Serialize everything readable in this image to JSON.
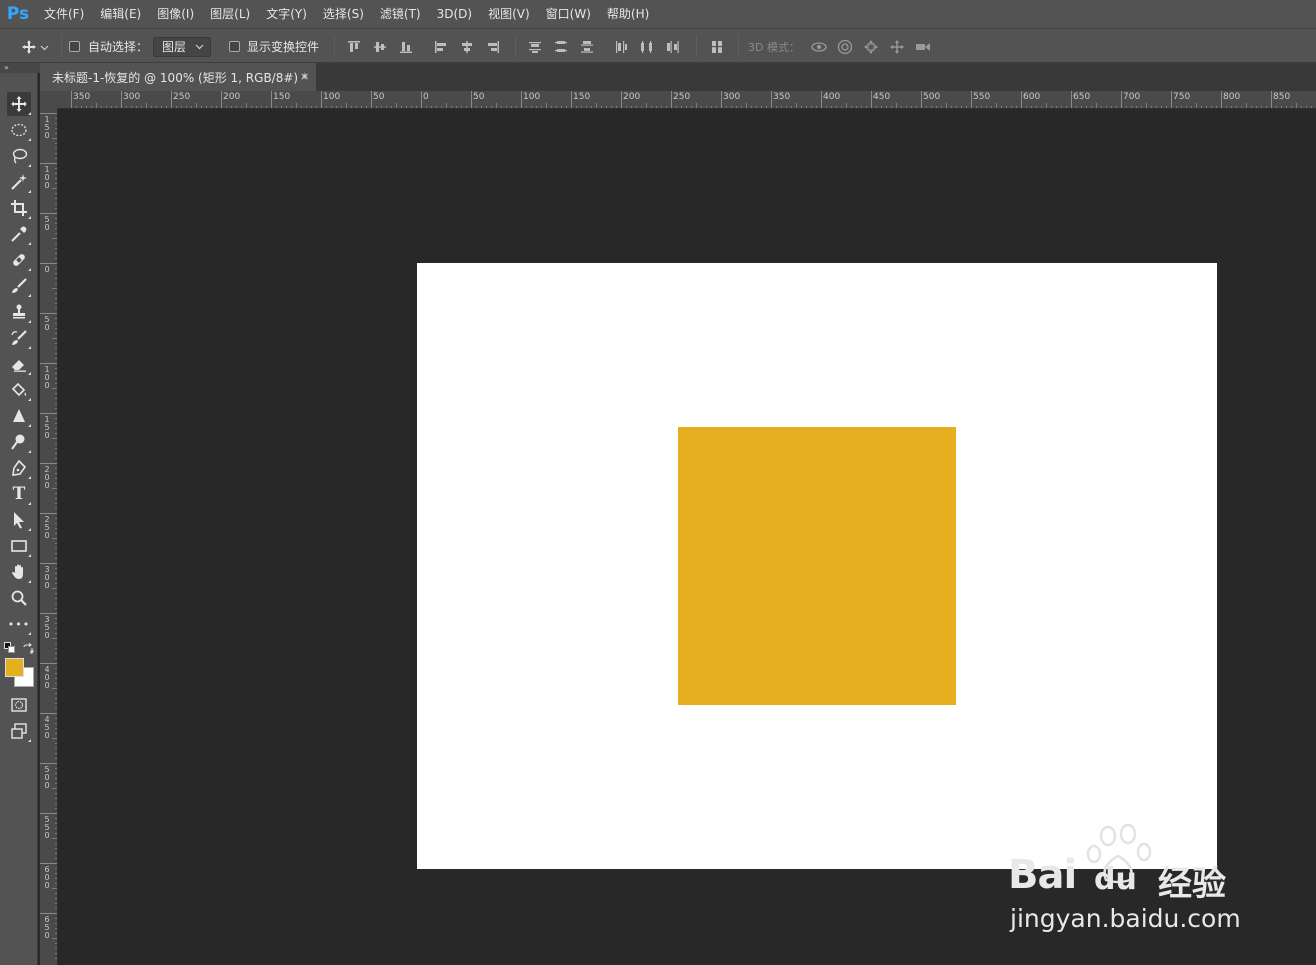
{
  "app": {
    "logo": "Ps"
  },
  "menu": [
    "文件(F)",
    "编辑(E)",
    "图像(I)",
    "图层(L)",
    "文字(Y)",
    "选择(S)",
    "滤镜(T)",
    "3D(D)",
    "视图(V)",
    "窗口(W)",
    "帮助(H)"
  ],
  "options": {
    "auto_select_label": "自动选择：",
    "auto_select_checked": false,
    "layer_select_value": "图层",
    "show_transform_label": "显示变换控件",
    "show_transform_checked": false,
    "mode_3d_label": "3D 模式："
  },
  "collapse_glyph": "»",
  "tab": {
    "title": "未标题-1-恢复的 @ 100% (矩形 1, RGB/8#) *",
    "close": "×"
  },
  "rulers": {
    "horizontal": [
      "350",
      "300",
      "250",
      "200",
      "150",
      "100",
      "50",
      "0",
      "50",
      "100",
      "150",
      "200",
      "250",
      "300",
      "350",
      "400",
      "450",
      "500",
      "550",
      "600",
      "650",
      "700",
      "750",
      "800",
      "850"
    ],
    "vertical": [
      "150",
      "100",
      "50",
      "0",
      "50",
      "100",
      "150",
      "200",
      "250",
      "300",
      "350",
      "400",
      "450",
      "500",
      "550",
      "600",
      "650"
    ]
  },
  "colors": {
    "foreground": "#e5af20",
    "background": "#ffffff",
    "rectangle_fill": "#e5af20",
    "canvas": "#ffffff"
  },
  "tools": [
    "move-tool",
    "marquee-tool",
    "lasso-tool",
    "magic-wand-tool",
    "crop-tool",
    "eyedropper-tool",
    "healing-brush-tool",
    "brush-tool",
    "clone-stamp-tool",
    "history-brush-tool",
    "eraser-tool",
    "paint-bucket-tool",
    "blur-tool",
    "dodge-tool",
    "pen-tool",
    "type-tool",
    "path-selection-tool",
    "rectangle-tool",
    "hand-tool",
    "zoom-tool",
    "more-tools"
  ],
  "type_tool_glyph": "T",
  "more_tools_glyph": "•••",
  "watermark": {
    "brand": "Bai",
    "brand_tail": "du",
    "product": "经验",
    "url": "jingyan.baidu.com"
  }
}
